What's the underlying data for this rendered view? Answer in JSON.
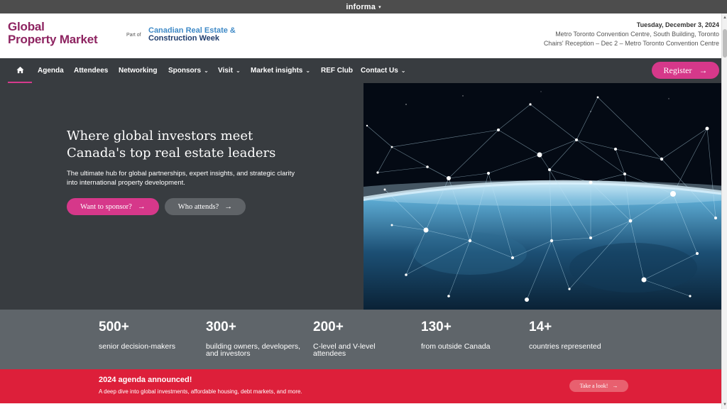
{
  "topbar": {
    "brand": "informa",
    "caret": "▾"
  },
  "header": {
    "logo_line1": "Global",
    "logo_line2": "Property Market",
    "part_of": "Part of",
    "partner_line1": "Canadian Real Estate &",
    "partner_line2": "Construction Week",
    "date": "Tuesday, December 3, 2024",
    "venue": "Metro Toronto Convention Centre, South Building, Toronto",
    "reception": "Chairs' Reception – Dec 2 – Metro Toronto Convention Centre"
  },
  "nav": {
    "items": [
      {
        "label": "Agenda",
        "dropdown": false
      },
      {
        "label": "Attendees",
        "dropdown": false
      },
      {
        "label": "Networking",
        "dropdown": false
      },
      {
        "label": "Sponsors",
        "dropdown": true
      },
      {
        "label": "Visit",
        "dropdown": true
      },
      {
        "label": "Market insights",
        "dropdown": true
      },
      {
        "label": "REF Club",
        "dropdown": false
      },
      {
        "label": "Contact Us",
        "dropdown": true
      }
    ],
    "chevron": "⌄",
    "register_label": "Register"
  },
  "hero": {
    "title_line1": "Where global investors meet",
    "title_line2": "Canada's top real estate leaders",
    "subtitle": "The ultimate hub for global partnerships, expert insights, and strategic clarity into international property development.",
    "btn_sponsor": "Want to sponsor?",
    "btn_attends": "Who attends?",
    "arrow": "→"
  },
  "stats": [
    {
      "number": "500+",
      "label": "senior decision-makers"
    },
    {
      "number": "300+",
      "label": "building owners, developers, and investors"
    },
    {
      "number": "200+",
      "label": "C-level and V-level attendees"
    },
    {
      "number": "130+",
      "label": "from outside Canada"
    },
    {
      "number": "14+",
      "label": "countries represented"
    }
  ],
  "banner": {
    "title": "2024 agenda announced!",
    "subtitle": "A deep dive into global investments, affordable housing, debt markets, and more.",
    "button": "Take a look!"
  },
  "colors": {
    "brand_magenta": "#8e2461",
    "accent_pink": "#d6388a",
    "nav_bg": "#383c40",
    "stats_bg": "#5f656a",
    "banner_red": "#dd1f3a"
  },
  "icons": {
    "home": "home-icon",
    "arrow": "arrow-right-icon",
    "chevron": "chevron-down-icon"
  }
}
